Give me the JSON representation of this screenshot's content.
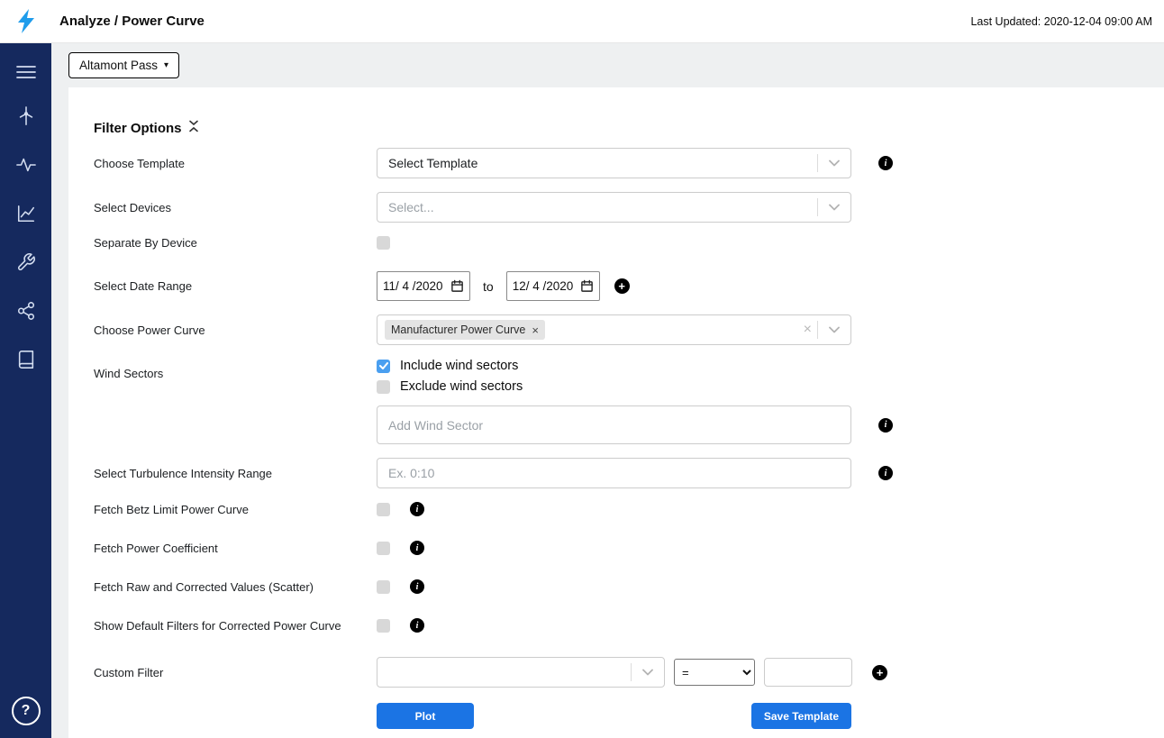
{
  "header": {
    "title": "Analyze / Power Curve",
    "last_updated": "Last Updated: 2020-12-04 09:00 AM"
  },
  "toolbar": {
    "site_selector_label": "Altamont Pass"
  },
  "icons": {
    "info": "i",
    "plus": "+",
    "close": "×",
    "caret": "▾",
    "help": "?"
  },
  "filters": {
    "title": "Filter Options",
    "choose_template": {
      "label": "Choose Template",
      "value": "Select Template"
    },
    "select_devices": {
      "label": "Select Devices",
      "placeholder": "Select..."
    },
    "separate_by_device": {
      "label": "Separate By Device",
      "checked": false
    },
    "date_range": {
      "label": "Select Date Range",
      "start_value": "11/ 4 /2020",
      "separator": "to",
      "end_value": "12/ 4 /2020"
    },
    "choose_power_curve": {
      "label": "Choose Power Curve",
      "selected_tag": "Manufacturer Power Curve"
    },
    "wind_sectors": {
      "label": "Wind Sectors",
      "include_label": "Include wind sectors",
      "include_checked": true,
      "exclude_label": "Exclude wind sectors",
      "exclude_checked": false,
      "add_placeholder": "Add Wind Sector"
    },
    "turbulence_range": {
      "label": "Select Turbulence Intensity Range",
      "placeholder": "Ex. 0:10"
    },
    "fetch_betz": {
      "label": "Fetch Betz Limit Power Curve",
      "checked": false
    },
    "fetch_power_coefficient": {
      "label": "Fetch Power Coefficient",
      "checked": false
    },
    "fetch_raw_corrected": {
      "label": "Fetch Raw and Corrected Values (Scatter)",
      "checked": false
    },
    "show_default_filters": {
      "label": "Show Default Filters for Corrected Power Curve",
      "checked": false
    },
    "custom_filter": {
      "label": "Custom Filter",
      "operator": "="
    },
    "actions": {
      "plot": "Plot",
      "save_template": "Save Template"
    }
  }
}
